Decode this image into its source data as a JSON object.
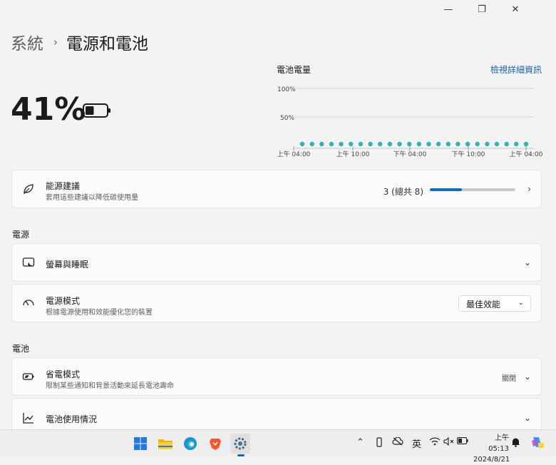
{
  "window": {
    "minimize_glyph": "—",
    "restore_glyph": "❐",
    "close_glyph": "✕"
  },
  "breadcrumb": {
    "parent": "系統",
    "separator": "›",
    "current": "電源和電池"
  },
  "battery": {
    "percent_text": "41%",
    "level": 0.41
  },
  "usage_chart": {
    "title": "電池電量",
    "link": "檢視詳細資訊",
    "y_ticks": [
      "100%",
      "50%"
    ],
    "x_ticks": [
      "上午 04:00",
      "上午 10:00",
      "下午 04:00",
      "下午 10:00",
      "上午 04:00"
    ]
  },
  "chart_data": {
    "type": "scatter",
    "title": "電池電量",
    "y_ticks": [
      "100%",
      "50%"
    ],
    "x_tick_labels": [
      "上午 04:00",
      "上午 10:00",
      "下午 04:00",
      "下午 10:00",
      "上午 04:00"
    ],
    "points_count": 24,
    "y_values": [
      0,
      0,
      0,
      0,
      0,
      0,
      0,
      0,
      0,
      0,
      0,
      0,
      0,
      0,
      0,
      0,
      0,
      0,
      0,
      0,
      0,
      0,
      0,
      0
    ],
    "ylim": [
      0,
      100
    ],
    "color": "#2fb3b3"
  },
  "energy_recommendations": {
    "title": "能源建議",
    "subtitle": "套用這些建議以降低碳使用量",
    "count_text": "3 (總共 8)",
    "progress": 0.375
  },
  "sections": {
    "power": "電源",
    "battery": "電池"
  },
  "screen_sleep": {
    "title": "螢幕與睡眠"
  },
  "power_mode": {
    "title": "電源模式",
    "subtitle": "根據電源使用和效能優化您的裝置",
    "value": "最佳效能"
  },
  "battery_saver": {
    "title": "省電模式",
    "subtitle": "限制某些通知和背景活動來延長電池壽命",
    "status": "關閉"
  },
  "battery_usage": {
    "title": "電池使用情況"
  },
  "taskbar": {
    "apps": [
      "start-icon",
      "file-explorer-icon",
      "edge-icon",
      "brave-icon",
      "settings-icon"
    ],
    "ime": "英",
    "time": "上午 05:13",
    "date": "2024/8/21"
  },
  "colors": {
    "accent": "#0f6cbd",
    "chart_dot": "#2fb3b3",
    "link": "#1a5fb4"
  }
}
